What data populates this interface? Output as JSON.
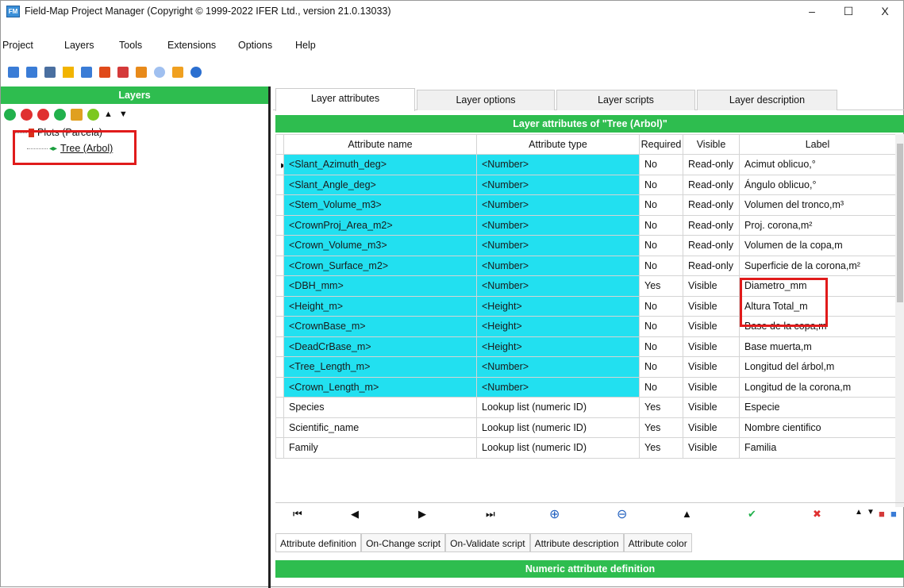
{
  "window": {
    "title": "Field-Map Project Manager (Copyright © 1999-2022 IFER Ltd., version 21.0.13033)",
    "icon_text": "FM",
    "minimize": "–",
    "maximize": "☐",
    "close": "X"
  },
  "menu": [
    "Project",
    "Layers",
    "Tools",
    "Extensions",
    "Options",
    "Help"
  ],
  "layers_panel": {
    "header": "Layers",
    "tree": [
      {
        "label": "Plots (Parcela)"
      },
      {
        "label": "Tree (Arbol)"
      }
    ]
  },
  "tabs": [
    "Layer attributes",
    "Layer options",
    "Layer scripts",
    "Layer description"
  ],
  "grid": {
    "header": "Layer attributes of \"Tree (Arbol)\"",
    "columns": [
      "Attribute name",
      "Attribute type",
      "Required",
      "Visible",
      "Label"
    ],
    "rows": [
      [
        "<Slant_Azimuth_deg>",
        "<Number>",
        "No",
        "Read-only",
        "Acimut oblicuo,°"
      ],
      [
        "<Slant_Angle_deg>",
        "<Number>",
        "No",
        "Read-only",
        "Ángulo oblicuo,°"
      ],
      [
        "<Stem_Volume_m3>",
        "<Number>",
        "No",
        "Read-only",
        "Volumen del tronco,m³"
      ],
      [
        "<CrownProj_Area_m2>",
        "<Number>",
        "No",
        "Read-only",
        "Proj. corona,m²"
      ],
      [
        "<Crown_Volume_m3>",
        "<Number>",
        "No",
        "Read-only",
        "Volumen de la copa,m"
      ],
      [
        "<Crown_Surface_m2>",
        "<Number>",
        "No",
        "Read-only",
        "Superficie de la corona,m²"
      ],
      [
        "<DBH_mm>",
        "<Number>",
        "Yes",
        "Visible",
        "Diametro_mm"
      ],
      [
        "<Height_m>",
        "<Height>",
        "No",
        "Visible",
        "Altura Total_m"
      ],
      [
        "<CrownBase_m>",
        "<Height>",
        "No",
        "Visible",
        "Base de la copa,m"
      ],
      [
        "<DeadCrBase_m>",
        "<Height>",
        "No",
        "Visible",
        "Base muerta,m"
      ],
      [
        "<Tree_Length_m>",
        "<Number>",
        "No",
        "Visible",
        "Longitud del árbol,m"
      ],
      [
        "<Crown_Length_m>",
        "<Number>",
        "No",
        "Visible",
        "Longitud de la corona,m"
      ],
      [
        "Species",
        "Lookup list (numeric ID)",
        "Yes",
        "Visible",
        "Especie"
      ],
      [
        "Scientific_name",
        "Lookup list (numeric ID)",
        "Yes",
        "Visible",
        "Nombre cientifico"
      ],
      [
        "Family",
        "Lookup list (numeric ID)",
        "Yes",
        "Visible",
        "Familia"
      ]
    ]
  },
  "subtabs": [
    "Attribute definition",
    "On-Change script",
    "On-Validate script",
    "Attribute description",
    "Attribute color"
  ],
  "numeric_definition_header": "Numeric attribute definition",
  "colors": {
    "green": "#2ebd4f",
    "cyan": "#22e0f0",
    "highlight": "#e01b1b"
  }
}
